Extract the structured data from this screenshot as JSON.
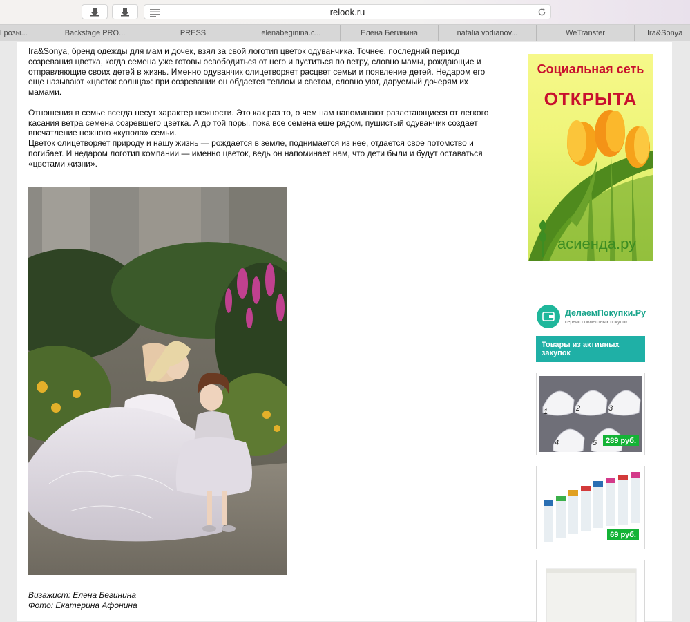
{
  "browser": {
    "url": "relook.ru",
    "bookmarks": [
      "l розы...",
      "Backstage PRO...",
      "PRESS",
      "elenabeginina.c...",
      "Елена Бегинина",
      "natalia vodianov...",
      "WeTransfer",
      "Ira&Sonya"
    ]
  },
  "article": {
    "paragraph1": "Ira&Sonya, бренд одежды для мам и дочек, взял за свой логотип цветок одуванчика. Точнее, последний период созревания цветка, когда семена уже готовы освободиться от него и пуститься по ветру, словно мамы, рождающие и отправляющие своих детей в жизнь. Именно одуванчик олицетворяет расцвет семьи и появление детей. Недаром его еще называют «цветок солнца»: при созревании он обдается теплом и светом, словно уют, даруемый дочерям их мамами.",
    "paragraph2": "Отношения в семье всегда несут характер нежности. Это как раз то, о чем нам напоминают разлетающиеся от легкого касания ветра семена созревшего цветка. А до той поры, пока все семена еще рядом, пушистый одуванчик создает впечатление нежного «купола» семьи.",
    "paragraph3": "Цветок олицетворяет природу и нашу жизнь — рождается в земле, поднимается из нее, отдается свое потомство и погибает. И недаром логотип компании — именно цветок, ведь он напоминает нам, что дети были и будут оставаться «цветами жизни».",
    "credit_makeup": "Визажист: Елена Бегинина",
    "credit_photo": "Фото: Екатерина Афонина"
  },
  "banner": {
    "line1": "Социальная сеть",
    "line2": "ОТКРЫТА",
    "brand": "асиенда.ру"
  },
  "widget": {
    "name": "ДелаемПокупки.Ру",
    "tagline": "сервис совместных покупок",
    "header": "Товары из активных закупок",
    "items": [
      {
        "price": "289 руб."
      },
      {
        "price": "69 руб."
      }
    ]
  },
  "colors": {
    "accent_teal": "#1fb0a6",
    "price_green": "#14b336",
    "banner_red": "#c8102e"
  }
}
